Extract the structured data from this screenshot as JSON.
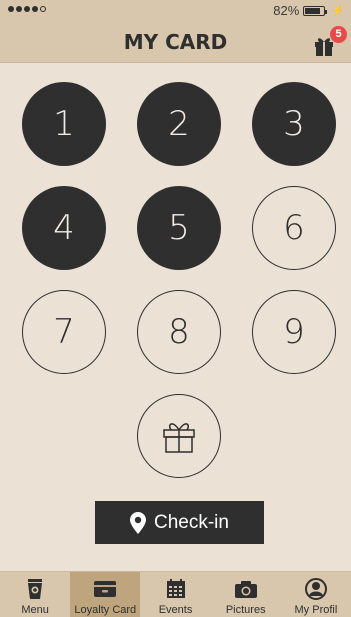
{
  "status_bar": {
    "battery_percent": "82%",
    "signal_dots_filled": 4,
    "signal_dots_total": 5
  },
  "header": {
    "title": "MY CARD",
    "gift_badge_count": "5"
  },
  "stamps": [
    {
      "label": "1",
      "state": "filled"
    },
    {
      "label": "2",
      "state": "filled"
    },
    {
      "label": "3",
      "state": "filled"
    },
    {
      "label": "4",
      "state": "filled"
    },
    {
      "label": "5",
      "state": "filled"
    },
    {
      "label": "6",
      "state": "empty"
    },
    {
      "label": "7",
      "state": "empty"
    },
    {
      "label": "8",
      "state": "empty"
    },
    {
      "label": "9",
      "state": "empty"
    }
  ],
  "reward": {
    "icon": "gift-icon"
  },
  "checkin": {
    "label": "Check-in",
    "icon": "location-pin-icon"
  },
  "tabs": [
    {
      "label": "Menu",
      "icon": "coffee-cup-icon",
      "active": false
    },
    {
      "label": "Loyalty Card",
      "icon": "card-icon",
      "active": true
    },
    {
      "label": "Events",
      "icon": "calendar-icon",
      "active": false
    },
    {
      "label": "Pictures",
      "icon": "camera-icon",
      "active": false
    },
    {
      "label": "My Profil",
      "icon": "profile-icon",
      "active": false
    }
  ],
  "colors": {
    "background": "#ebe1d5",
    "bar": "#d8c6ad",
    "active_tab": "#bfa57e",
    "dark": "#2f2f2f",
    "badge": "#e84a4a"
  }
}
